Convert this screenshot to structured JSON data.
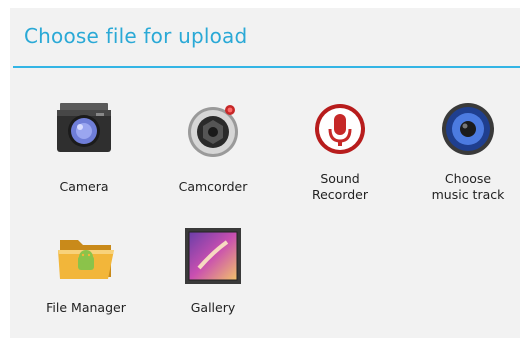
{
  "dialog": {
    "title": "Choose file for upload",
    "accent_color": "#33b5e5",
    "items": [
      {
        "label": "Camera",
        "icon": "camera-icon"
      },
      {
        "label": "Camcorder",
        "icon": "camcorder-icon"
      },
      {
        "label": "Sound\nRecorder",
        "icon": "sound-recorder-icon"
      },
      {
        "label": "Choose\nmusic track",
        "icon": "music-track-icon"
      },
      {
        "label": "File Manager",
        "icon": "file-manager-icon"
      },
      {
        "label": "Gallery",
        "icon": "gallery-icon"
      }
    ]
  }
}
